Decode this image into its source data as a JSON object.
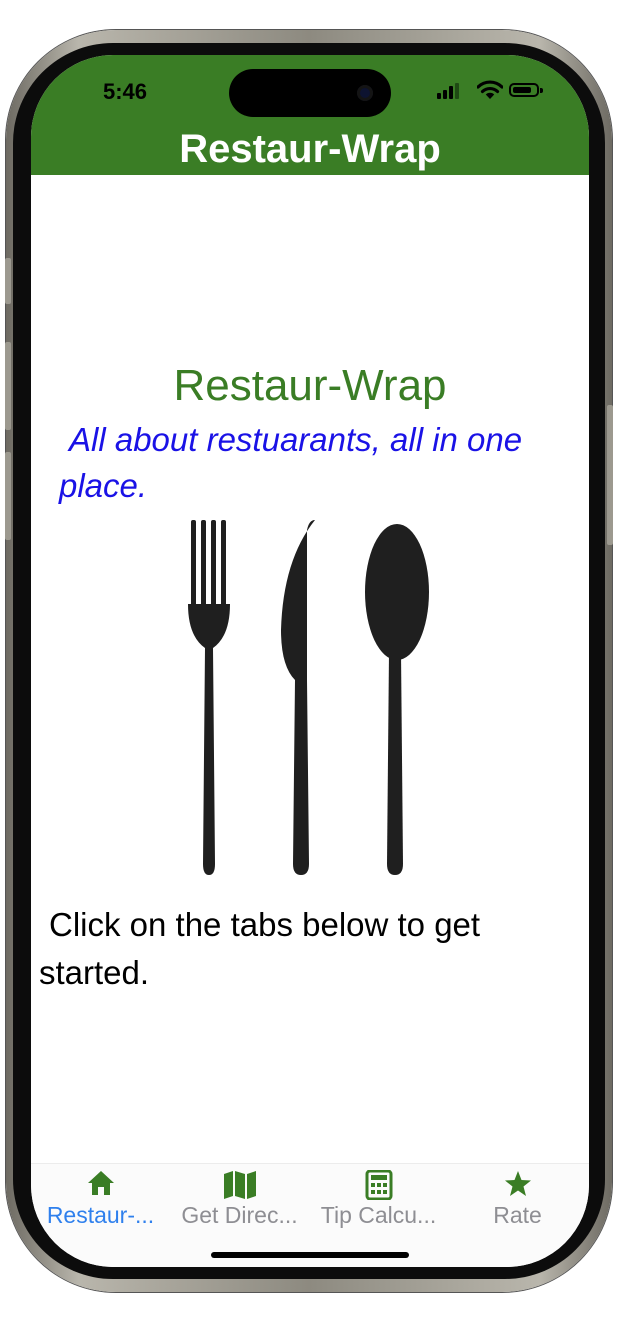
{
  "status_bar": {
    "time": "5:46",
    "icons": [
      "cellular-signal-icon",
      "wifi-icon",
      "battery-icon"
    ]
  },
  "header": {
    "title": "Restaur-Wrap",
    "background_color": "#3a7d25"
  },
  "main": {
    "title": "Restaur-Wrap",
    "title_color": "#3a7d25",
    "tagline": "All about restuarants, all in one place.",
    "tagline_color": "#1a12e6",
    "image": "fork-knife-spoon-icon",
    "instructions": "Click on the tabs below to get started."
  },
  "tabbar": {
    "active_color": "#2f80ed",
    "inactive_color": "#8e8e93",
    "icon_color": "#3a7d25",
    "tabs": [
      {
        "label": "Restaur-...",
        "icon": "house-icon",
        "active": true
      },
      {
        "label": "Get Direc...",
        "icon": "map-icon",
        "active": false
      },
      {
        "label": "Tip Calcu...",
        "icon": "calculator-icon",
        "active": false
      },
      {
        "label": "Rate",
        "icon": "star-icon",
        "active": false
      }
    ]
  }
}
